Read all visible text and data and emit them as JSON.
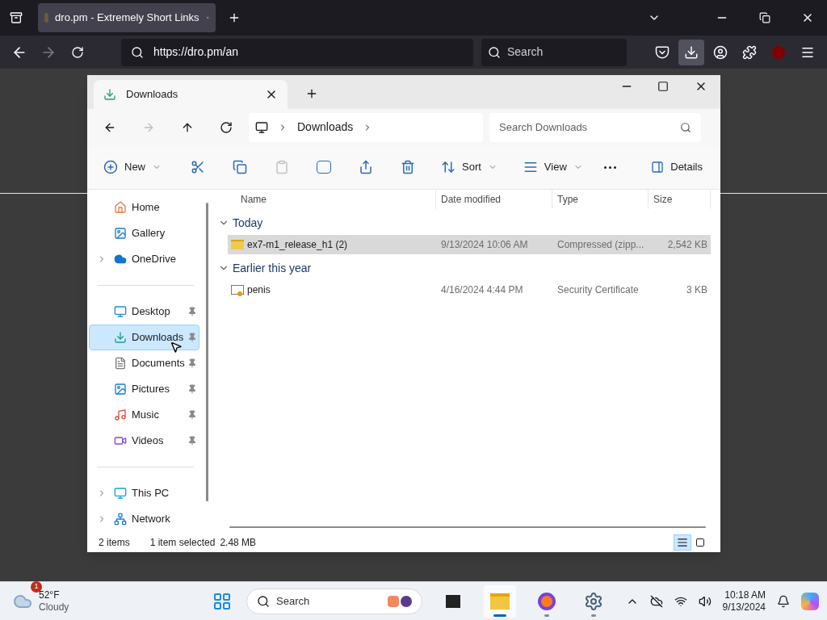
{
  "browser": {
    "tab": {
      "title": "dro.pm - Extremely Short Links"
    },
    "address": "https://dro.pm/an",
    "search": {
      "placeholder": "Search"
    },
    "toolbar_buttons": [
      {
        "selected": false
      },
      {
        "selected": true
      },
      {
        "selected": false
      },
      {
        "selected": false
      },
      {
        "selected": false
      },
      {
        "selected": false
      }
    ]
  },
  "explorer": {
    "tab": {
      "title": "Downloads"
    },
    "breadcrumb": [
      "Downloads"
    ],
    "search": {
      "placeholder": "Search Downloads"
    },
    "commands": [
      {
        "label": "New",
        "dropdown": true,
        "disabled": false
      },
      {
        "disabled": false
      },
      {
        "disabled": false
      },
      {
        "disabled": true
      },
      {
        "disabled": false
      },
      {
        "disabled": false
      },
      {
        "disabled": false
      },
      {
        "label": "Sort",
        "dropdown": true,
        "disabled": false
      },
      {
        "label": "View",
        "dropdown": true,
        "disabled": false
      },
      {
        "disabled": false
      }
    ],
    "details_button": "Details",
    "sidebar": [
      [
        {
          "name": "Home",
          "selected": false,
          "pinned": false
        },
        {
          "name": "Gallery",
          "selected": false,
          "pinned": false
        },
        {
          "name": "OneDrive",
          "selected": false,
          "pinned": false,
          "expanded": false
        }
      ],
      [
        {
          "name": "Desktop",
          "selected": false,
          "pinned": true
        },
        {
          "name": "Downloads",
          "selected": true,
          "pinned": true
        },
        {
          "name": "Documents",
          "selected": false,
          "pinned": true
        },
        {
          "name": "Pictures",
          "selected": false,
          "pinned": true
        },
        {
          "name": "Music",
          "selected": false,
          "pinned": true
        },
        {
          "name": "Videos",
          "selected": false,
          "pinned": true
        }
      ],
      [
        {
          "name": "This PC",
          "selected": false,
          "pinned": false,
          "expanded": false
        },
        {
          "name": "Network",
          "selected": false,
          "pinned": false,
          "expanded": false
        }
      ]
    ],
    "columns": [
      "Name",
      "Date modified",
      "Type",
      "Size"
    ],
    "groups": [
      {
        "label": "Today",
        "expanded": true,
        "files": [
          {
            "kind": "zip",
            "name": "ex7-m1_release_h1 (2)",
            "date": "9/13/2024 10:06 AM",
            "type": "Compressed (zipp...",
            "size": "2,542 KB",
            "selected": true
          }
        ]
      },
      {
        "label": "Earlier this year",
        "expanded": true,
        "files": [
          {
            "kind": "certificate",
            "name": "penis",
            "date": "4/16/2024 4:44 PM",
            "type": "Security Certificate",
            "size": "3 KB",
            "selected": false
          }
        ]
      }
    ],
    "status": {
      "count": "2 items",
      "selection": "1 item selected",
      "size": "2.48 MB"
    },
    "view_modes": [
      {
        "selected": true
      },
      {
        "selected": false
      }
    ]
  },
  "taskbar": {
    "weather": {
      "badge": "1",
      "temperature": "52°F",
      "condition": "Cloudy"
    },
    "search": {
      "placeholder": "Search"
    },
    "apps": [
      {
        "selected": false,
        "running": false
      },
      {
        "selected": true,
        "running": true
      },
      {
        "selected": false,
        "running": true
      },
      {
        "selected": false,
        "running": true
      }
    ],
    "time": "10:18 AM",
    "date": "9/13/2024"
  }
}
